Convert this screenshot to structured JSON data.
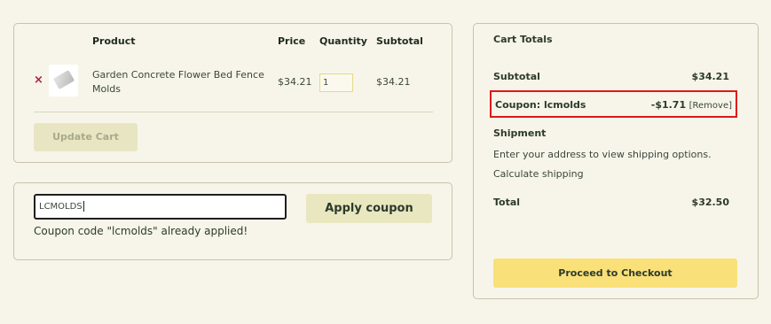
{
  "cart": {
    "headers": {
      "product": "Product",
      "price": "Price",
      "quantity": "Quantity",
      "subtotal": "Subtotal"
    },
    "items": [
      {
        "remove_icon": "×",
        "name": "Garden Concrete Flower Bed Fence Molds",
        "price": "$34.21",
        "quantity": "1",
        "subtotal": "$34.21"
      }
    ],
    "update_label": "Update Cart"
  },
  "coupon": {
    "value": "LCMOLDS",
    "apply_label": "Apply coupon",
    "message": "Coupon code \"lcmolds\" already applied!"
  },
  "totals": {
    "title": "Cart Totals",
    "subtotal_label": "Subtotal",
    "subtotal_value": "$34.21",
    "coupon_label": "Coupon: lcmolds",
    "coupon_amount": "-$1.71",
    "coupon_remove": "[Remove]",
    "shipment_label": "Shipment",
    "shipment_note": "Enter your address to view shipping options.",
    "calculate_shipping": "Calculate shipping",
    "total_label": "Total",
    "total_value": "$32.50",
    "checkout_label": "Proceed to Checkout"
  },
  "colors": {
    "background": "#f7f5ea",
    "highlight_border": "#e01818",
    "checkout_button": "#fae078",
    "apply_button": "#e8e7bf",
    "remove_icon": "#b0203a"
  }
}
